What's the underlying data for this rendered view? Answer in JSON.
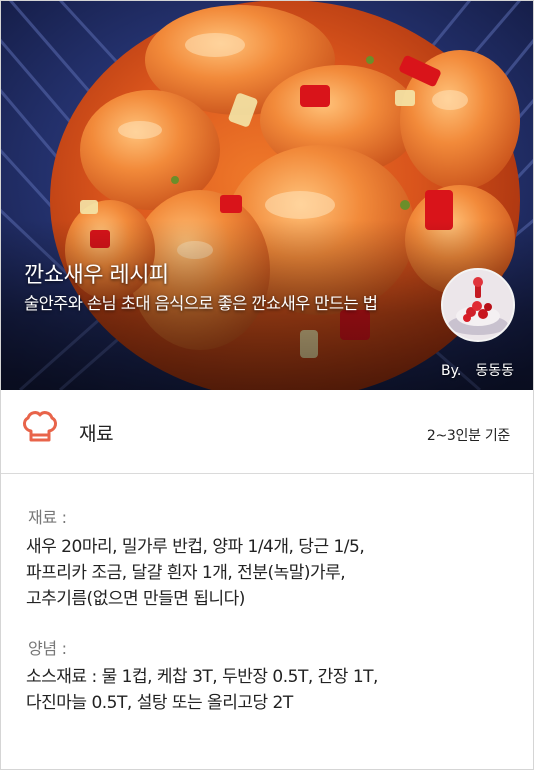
{
  "recipe": {
    "title": "깐쇼새우 레시피",
    "subtitle": "술안주와 손님 초대 음식으로 좋은 깐쇼새우 만드는 법",
    "author_prefix": "By.",
    "author_name": "동동동"
  },
  "ingredients_header": {
    "icon": "chef-hat-icon",
    "title": "재료",
    "servings": "2~3인분 기준"
  },
  "sections": {
    "ingredients": {
      "label": "재료 :",
      "lines": [
        "새우 20마리, 밀가루 반컵, 양파 1/4개, 당근 1/5,",
        "파프리카 조금, 달걀 흰자 1개, 전분(녹말)가루,",
        "고추기름(없으면 만들면 됩니다)"
      ]
    },
    "seasoning": {
      "label": "양념 :",
      "lines": [
        "소스재료 : 물 1컵, 케찹 3T, 두반장 0.5T, 간장 1T,",
        "다진마늘 0.5T, 설탕 또는 올리고당 2T"
      ]
    }
  },
  "colors": {
    "accent": "#e8644a",
    "label_gray": "#777777",
    "divider": "#dadada"
  }
}
